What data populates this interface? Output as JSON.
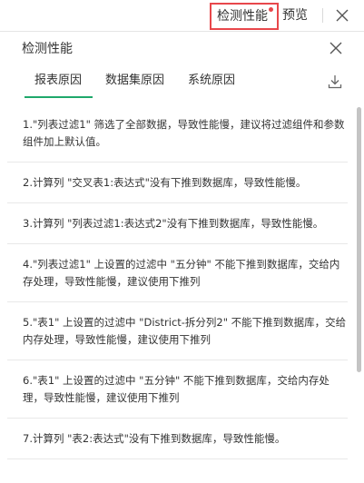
{
  "topbar": {
    "detect_label": "检测性能",
    "preview_label": "预览",
    "close_icon": "close-icon"
  },
  "panel": {
    "title": "检测性能",
    "close_icon": "close-icon"
  },
  "tabs": [
    {
      "label": "报表原因",
      "active": true
    },
    {
      "label": "数据集原因",
      "active": false
    },
    {
      "label": "系统原因",
      "active": false
    }
  ],
  "download_icon": "download-icon",
  "colors": {
    "accent_green": "#1fa86b",
    "highlight_red": "#e8474b"
  },
  "reasons": [
    "1.\"列表过滤1\" 筛选了全部数据，导致性能慢，建议将过滤组件和参数组件加上默认值。",
    "2.计算列 \"交叉表1:表达式\"没有下推到数据库，导致性能慢。",
    "3.计算列 \"列表过滤1:表达式2\"没有下推到数据库，导致性能慢。",
    "4.\"列表过滤1\" 上设置的过滤中 \"五分钟\" 不能下推到数据库，交给内存处理，导致性能慢，建议使用下推列",
    "5.\"表1\" 上设置的过滤中 \"District-拆分列2\" 不能下推到数据库，交给内存处理，导致性能慢，建议使用下推列",
    "6.\"表1\" 上设置的过滤中 \"五分钟\" 不能下推到数据库，交给内存处理，导致性能慢，建议使用下推列",
    "7.计算列 \"表2:表达式\"没有下推到数据库，导致性能慢。"
  ]
}
